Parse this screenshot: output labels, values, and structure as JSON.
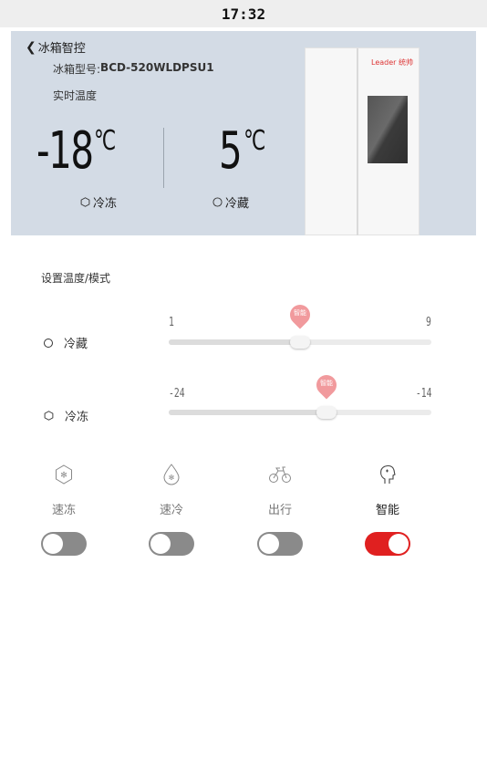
{
  "status_bar": {
    "time": "17:32"
  },
  "header": {
    "back_label": "冰箱智控",
    "model_prefix": "冰箱型号:",
    "model_value": "BCD-520WLDPSU1",
    "realtime_label": "实时温度"
  },
  "realtime": {
    "freeze_temp": "-18",
    "fridge_temp": "5",
    "unit": "℃",
    "freeze_label": "冷冻",
    "fridge_label": "冷藏"
  },
  "product": {
    "brand_text": "Leader 统帅"
  },
  "settings": {
    "title": "设置温度/模式",
    "fridge": {
      "label": "冷藏",
      "min": "1",
      "max": "9",
      "value": 5,
      "pin_label": "智能"
    },
    "freezer": {
      "label": "冷冻",
      "min": "-24",
      "max": "-14",
      "value": -18,
      "pin_label": "智能"
    }
  },
  "modes": [
    {
      "name": "quick-freeze",
      "label": "速冻",
      "icon": "snowflake-hex-icon",
      "on": false
    },
    {
      "name": "quick-cool",
      "label": "速冷",
      "icon": "drop-snowflake-icon",
      "on": false
    },
    {
      "name": "travel",
      "label": "出行",
      "icon": "bicycle-icon",
      "on": false
    },
    {
      "name": "smart",
      "label": "智能",
      "icon": "smart-head-icon",
      "on": true
    }
  ],
  "colors": {
    "accent": "#e02020",
    "hero_bg": "#d3dbe5",
    "pin": "#f19a9d",
    "toggle_off": "#8a8a8a"
  }
}
